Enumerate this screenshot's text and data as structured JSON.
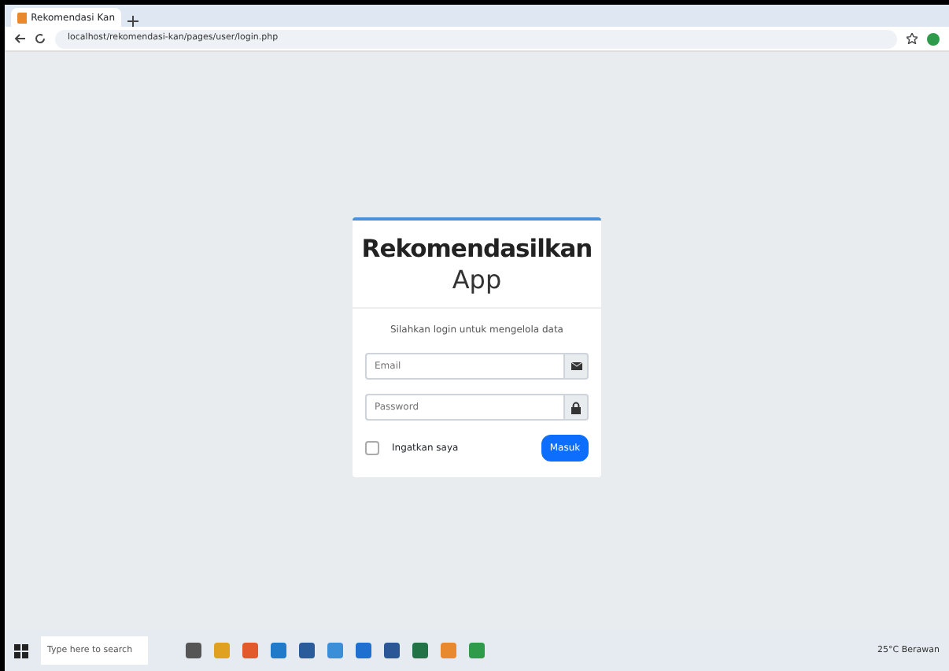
{
  "browser": {
    "tab_title": "Rekomendasi Kan",
    "url": "localhost/rekomendasi-kan/pages/user/login.php"
  },
  "login": {
    "title": "Rekomendasilkan",
    "subtitle": "App",
    "message": "Silahkan login untuk mengelola data",
    "fields": [
      {
        "kind": "email",
        "placeholder": "Email"
      },
      {
        "kind": "password",
        "placeholder": "Password"
      }
    ],
    "remember": {
      "label": "Ingatkan saya",
      "checked": false
    },
    "submit": "Masuk"
  },
  "taskbar": {
    "search_placeholder": "Type here to search",
    "weather": "25°C Berawan"
  }
}
